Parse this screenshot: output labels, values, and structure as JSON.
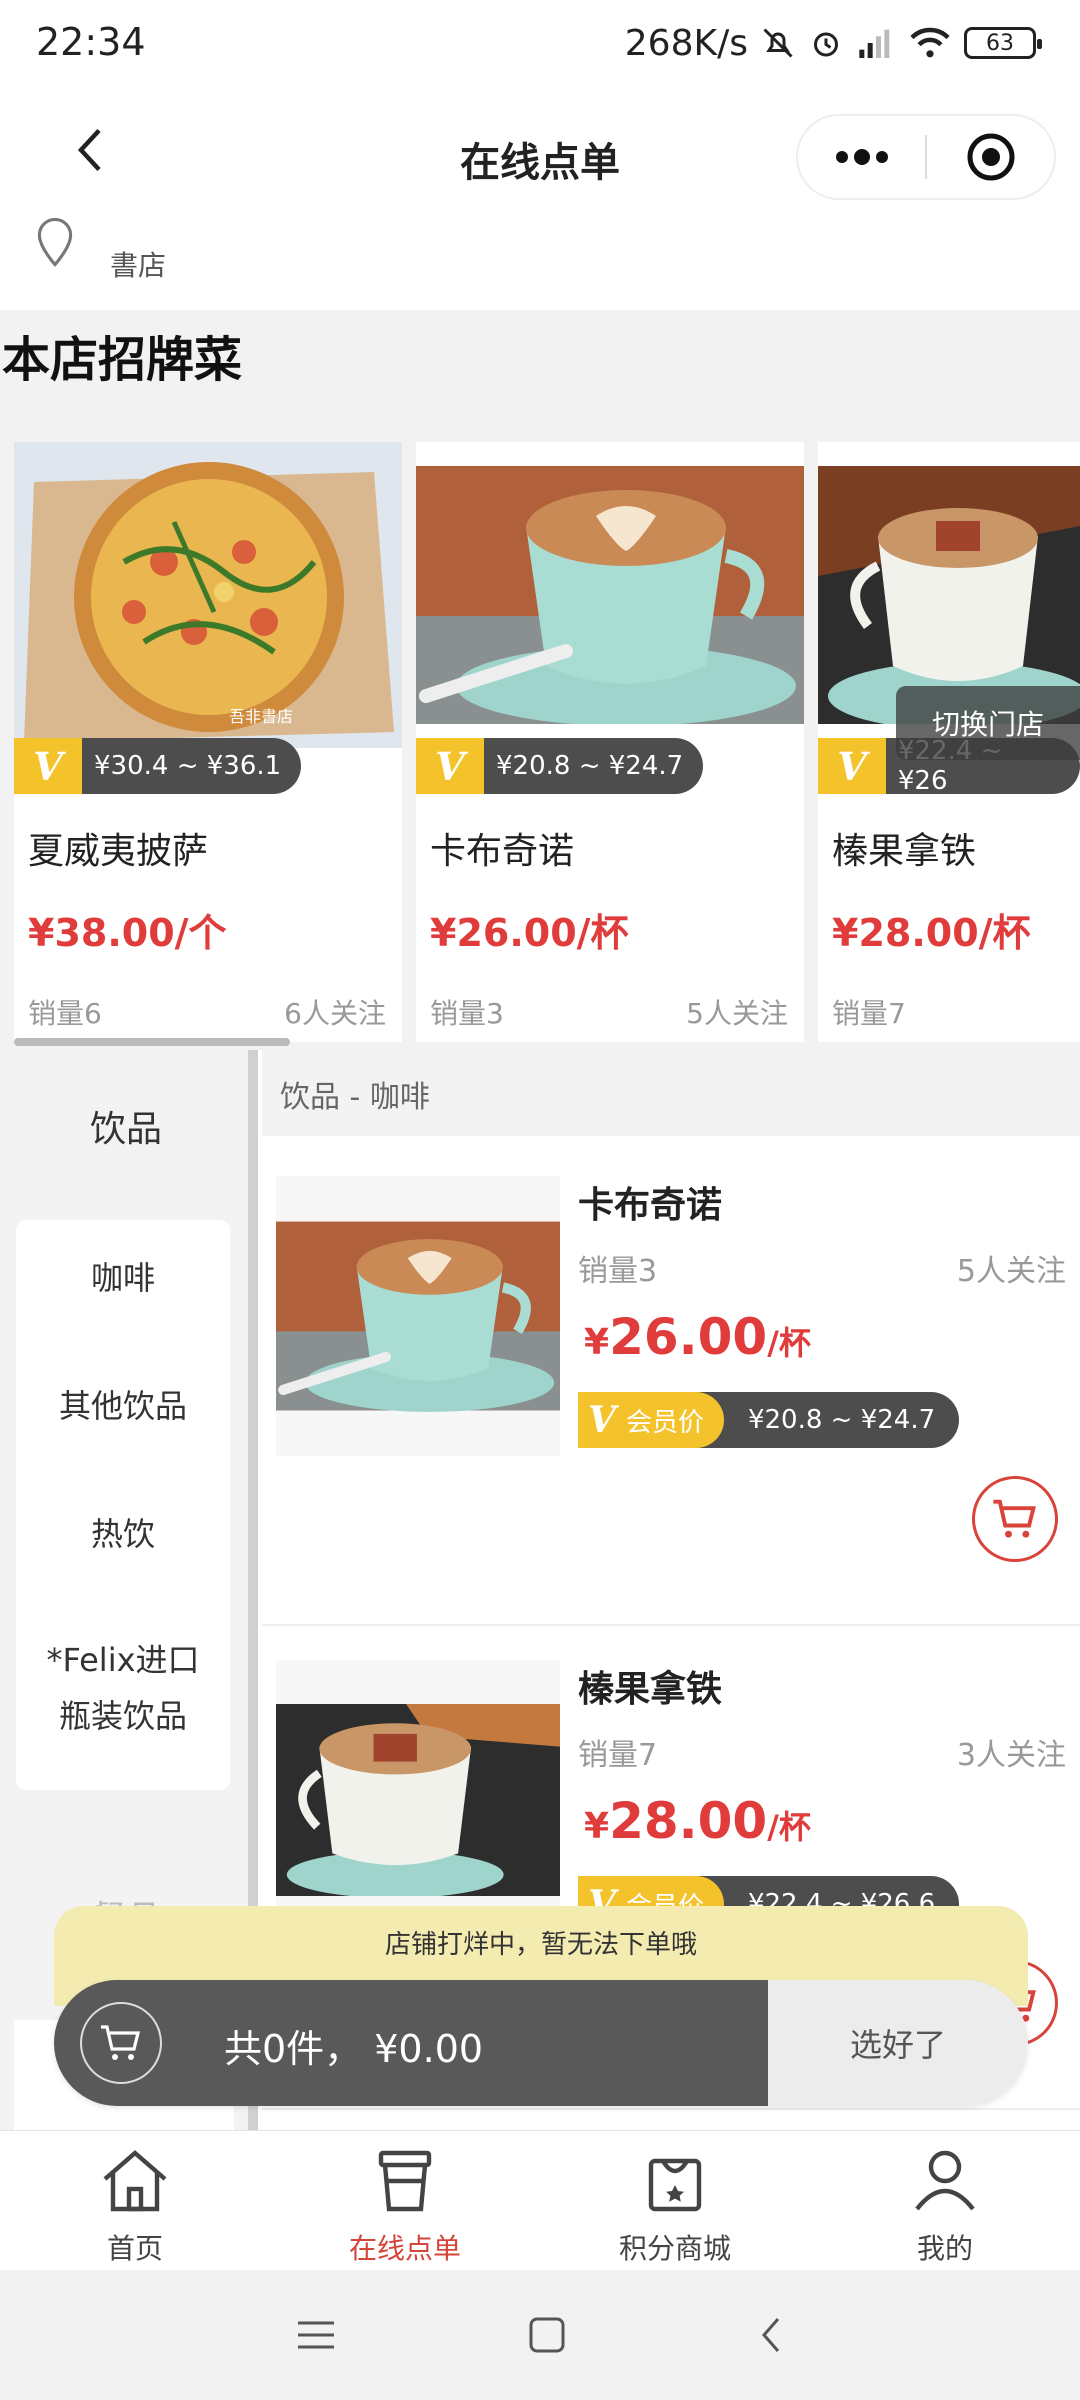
{
  "status_bar": {
    "time": "22:34",
    "net_speed": "268K/s",
    "battery": "63"
  },
  "header": {
    "title": "在线点单"
  },
  "address": {
    "line2": "書店"
  },
  "signature": {
    "title": "本店招牌菜",
    "switch_store": "切换门店",
    "cards": [
      {
        "name": "夏威夷披萨",
        "vip_range": "¥30.4 ~ ¥36.1",
        "price": "¥38.00/个",
        "sales": "销量6",
        "follows": "6人关注",
        "watermark": "吾非書店"
      },
      {
        "name": "卡布奇诺",
        "vip_range": "¥20.8 ~ ¥24.7",
        "price": "¥26.00/杯",
        "sales": "销量3",
        "follows": "5人关注"
      },
      {
        "name": "榛果拿铁",
        "vip_range": "¥22.4 ~ ¥26",
        "price": "¥28.00/杯",
        "sales": "销量7",
        "follows": ""
      }
    ]
  },
  "menu": {
    "category": "饮品",
    "next_category": "餐品",
    "subcategories": [
      "咖啡",
      "其他饮品",
      "热饮",
      "*Felix进口",
      "瓶装饮品"
    ],
    "breadcrumb": "饮品 - 咖啡",
    "vip_label": "会员价",
    "items": [
      {
        "name": "卡布奇诺",
        "sales": "销量3",
        "follows": "5人关注",
        "currency": "¥",
        "amount": "26.00",
        "unit": "/杯",
        "vip_range": "¥20.8 ~ ¥24.7"
      },
      {
        "name": "榛果拿铁",
        "sales": "销量7",
        "follows": "3人关注",
        "currency": "¥",
        "amount": "28.00",
        "unit": "/杯",
        "vip_range": "¥22.4 ~ ¥26.6"
      }
    ]
  },
  "cart": {
    "notice": "店铺打烊中，暂无法下单哦",
    "total": "共0件， ¥0.00",
    "confirm": "选好了"
  },
  "tabs": [
    {
      "label": "首页",
      "icon": "home-icon"
    },
    {
      "label": "在线点单",
      "icon": "cup-icon",
      "active": true
    },
    {
      "label": "积分商城",
      "icon": "bag-icon"
    },
    {
      "label": "我的",
      "icon": "person-icon"
    }
  ],
  "colors": {
    "accent_red": "#e03c3c",
    "vip_yellow": "#f4c32c",
    "dark_gray": "#4d4d4d",
    "notice_yellow": "#f4ebb1"
  }
}
